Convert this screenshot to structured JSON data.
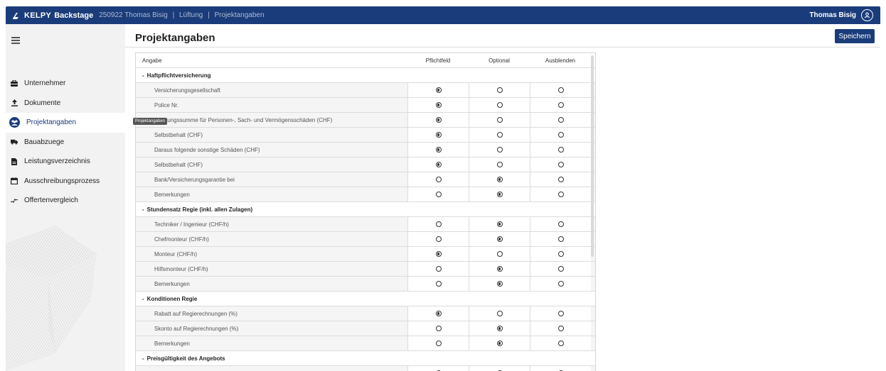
{
  "topbar": {
    "brand_kelpy": "KELPY",
    "brand_backstage": "Backstage",
    "project": "250922 Thomas Bisig",
    "section": "Lüftung",
    "page": "Projektangaben",
    "separator": "|",
    "user": "Thomas Bisig",
    "user_icon": "user-circle-icon",
    "brand_color": "#1a3c7a"
  },
  "sidebar": {
    "items": [
      {
        "label": "Unternehmer",
        "icon": "briefcase-icon"
      },
      {
        "label": "Dokumente",
        "icon": "upload-icon"
      },
      {
        "label": "Projektangaben",
        "icon": "people-icon",
        "active": true
      },
      {
        "label": "Bauabzuege",
        "icon": "truck-icon"
      },
      {
        "label": "Leistungsverzeichnis",
        "icon": "document-icon"
      },
      {
        "label": "Ausschreibungsprozess",
        "icon": "calendar-icon"
      },
      {
        "label": "Offertenvergleich",
        "icon": "compare-icon"
      }
    ],
    "tooltip": "Projektangaben"
  },
  "main": {
    "title": "Projektangaben",
    "save_label": "Speichern"
  },
  "table": {
    "columns": [
      "Angabe",
      "Pflichtfeld",
      "Optional",
      "Ausblenden"
    ],
    "rows": [
      {
        "type": "group",
        "label": "Haftpflichtversicherung"
      },
      {
        "type": "item",
        "label": "Versicherungsgesellschaft",
        "selected": 0
      },
      {
        "type": "item",
        "label": "Police Nr.",
        "selected": 0
      },
      {
        "type": "item",
        "label": "Deckungssumme für Personen-, Sach- und Vermögensschäden (CHF)",
        "selected": 0
      },
      {
        "type": "item",
        "label": "Selbstbehalt (CHF)",
        "selected": 0
      },
      {
        "type": "item",
        "label": "Daraus folgende sonstige Schäden (CHF)",
        "selected": 0
      },
      {
        "type": "item",
        "label": "Selbstbehalt (CHF)",
        "selected": 0
      },
      {
        "type": "item",
        "label": "Bank/Versicherungsgarantie bei",
        "selected": 1
      },
      {
        "type": "item",
        "label": "Bemerkungen",
        "selected": 1
      },
      {
        "type": "group",
        "label": "Stundensatz Regie (inkl. allen Zulagen)"
      },
      {
        "type": "item",
        "label": "Techniker / Ingenieur (CHF/h)",
        "selected": 1
      },
      {
        "type": "item",
        "label": "Chefmonteur (CHF/h)",
        "selected": 1
      },
      {
        "type": "item",
        "label": "Monteur (CHF/h)",
        "selected": 0
      },
      {
        "type": "item",
        "label": "Hilfsmonteur (CHF/h)",
        "selected": 1
      },
      {
        "type": "item",
        "label": "Bemerkungen",
        "selected": 1
      },
      {
        "type": "group",
        "label": "Konditionen Regie"
      },
      {
        "type": "item",
        "label": "Rabatt auf Regierechnungen (%)",
        "selected": 0
      },
      {
        "type": "item",
        "label": "Skonto auf Regierechnungen (%)",
        "selected": 1
      },
      {
        "type": "item",
        "label": "Bemerkungen",
        "selected": 1
      },
      {
        "type": "group",
        "label": "Preisgültigkeit des Angebots"
      },
      {
        "type": "item",
        "label": "Preisgültigkeit ab Eingabezeitpunkt (Anzahl Tage)",
        "selected": 0
      }
    ]
  }
}
